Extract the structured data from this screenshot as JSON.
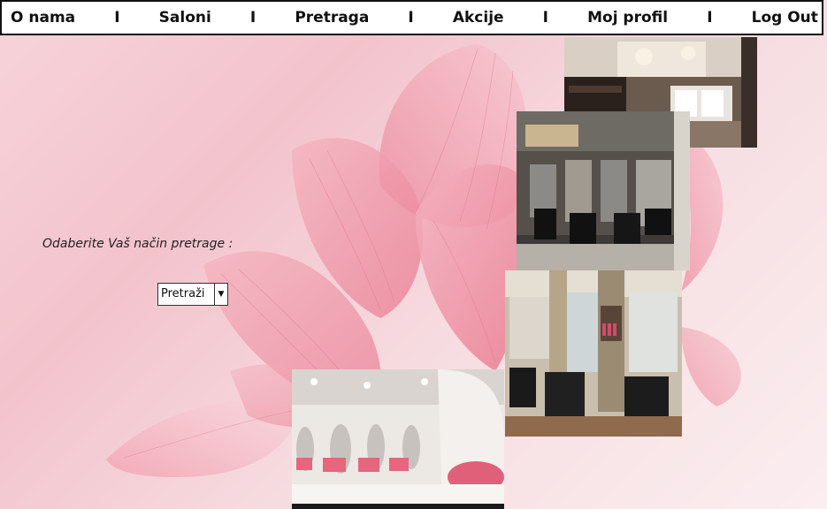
{
  "nav": {
    "items": [
      {
        "label": "O nama"
      },
      {
        "label": "Saloni"
      },
      {
        "label": "Pretraga"
      },
      {
        "label": "Akcije"
      },
      {
        "label": "Moj profil"
      },
      {
        "label": "Log Out"
      }
    ],
    "separator": "I"
  },
  "search": {
    "prompt": "Odaberite Vaš način pretrage :",
    "select_value": "Pretraži",
    "arrow_icon": "triangle-down"
  },
  "photos": [
    {
      "name": "salon-photo-interior-1"
    },
    {
      "name": "salon-photo-interior-2"
    },
    {
      "name": "salon-photo-interior-3"
    },
    {
      "name": "salon-photo-interior-4"
    }
  ],
  "colors": {
    "background": "#f5d0d7",
    "petal": "#ef9aab",
    "nav_border": "#111111"
  }
}
